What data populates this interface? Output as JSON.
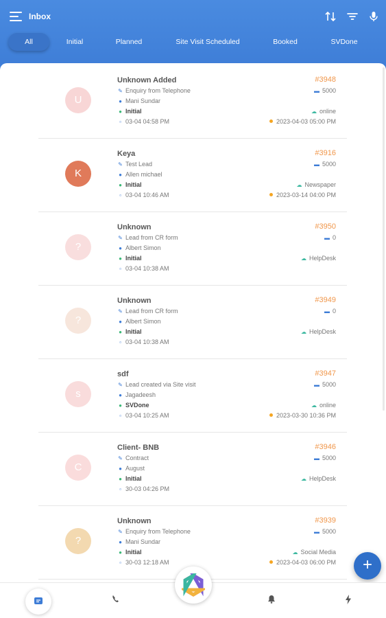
{
  "header": {
    "title": "Inbox",
    "background_color": "#3d7cd6",
    "icons": [
      "menu-icon",
      "sort-icon",
      "filter-icon",
      "mic-icon"
    ]
  },
  "tabs": [
    {
      "label": "All",
      "active": true
    },
    {
      "label": "Initial",
      "active": false
    },
    {
      "label": "Planned",
      "active": false
    },
    {
      "label": "Site Visit Scheduled",
      "active": false
    },
    {
      "label": "Booked",
      "active": false
    },
    {
      "label": "SVDone",
      "active": false
    }
  ],
  "leads": [
    {
      "initial": "U",
      "avatar_color": "#f8d6d6",
      "name": "Unknown Added",
      "id": "#3948",
      "description": "Enquiry from Telephone",
      "assignee": "Mani Sundar",
      "status": "Initial",
      "created": "03-04 04:58 PM",
      "amount": "5000",
      "source": "online",
      "followup": "2023-04-03 05:00 PM"
    },
    {
      "initial": "K",
      "avatar_color": "#e07a5a",
      "name": "Keya",
      "id": "#3916",
      "description": "Test Lead",
      "assignee": "Allen michael",
      "status": "Initial",
      "created": "03-04 10:46 AM",
      "amount": "5000",
      "source": "Newspaper",
      "followup": "2023-03-14 04:00 PM"
    },
    {
      "initial": "?",
      "avatar_color": "#f9dede",
      "name": "Unknown",
      "id": "#3950",
      "description": "Lead from CR form",
      "assignee": "Albert Simon",
      "status": "Initial",
      "created": "03-04 10:38 AM",
      "amount": "0",
      "source": "HelpDesk",
      "followup": ""
    },
    {
      "initial": "?",
      "avatar_color": "#f7e6dc",
      "name": "Unknown",
      "id": "#3949",
      "description": "Lead from CR form",
      "assignee": "Albert Simon",
      "status": "Initial",
      "created": "03-04 10:38 AM",
      "amount": "0",
      "source": "HelpDesk",
      "followup": ""
    },
    {
      "initial": "s",
      "avatar_color": "#f9dcdc",
      "name": "sdf",
      "id": "#3947",
      "description": "Lead created via Site visit",
      "assignee": "Jagadeesh",
      "status": "SVDone",
      "created": "03-04 10:25 AM",
      "amount": "5000",
      "source": "online",
      "followup": "2023-03-30 10:36 PM"
    },
    {
      "initial": "C",
      "avatar_color": "#fadcdc",
      "name": "Client- BNB",
      "id": "#3946",
      "description": "Contract",
      "assignee": "August",
      "status": "Initial",
      "created": "30-03 04:26 PM",
      "amount": "5000",
      "source": "HelpDesk",
      "followup": ""
    },
    {
      "initial": "?",
      "avatar_color": "#f3d9b0",
      "name": "Unknown",
      "id": "#3939",
      "description": "Enquiry from Telephone",
      "assignee": "Mani Sundar",
      "status": "Initial",
      "created": "30-03 12:18 AM",
      "amount": "5000",
      "source": "Social Media",
      "followup": "2023-04-03 06:00 PM"
    }
  ],
  "colors": {
    "lead_id": "#f0964a",
    "followup_dot": "#f5a623",
    "fab": "#2f6fc9"
  },
  "bottom_nav": {
    "items": [
      "chat-icon",
      "phone-icon",
      "logo",
      "bell-icon",
      "flash-icon"
    ]
  },
  "fab": {
    "label": "+"
  }
}
